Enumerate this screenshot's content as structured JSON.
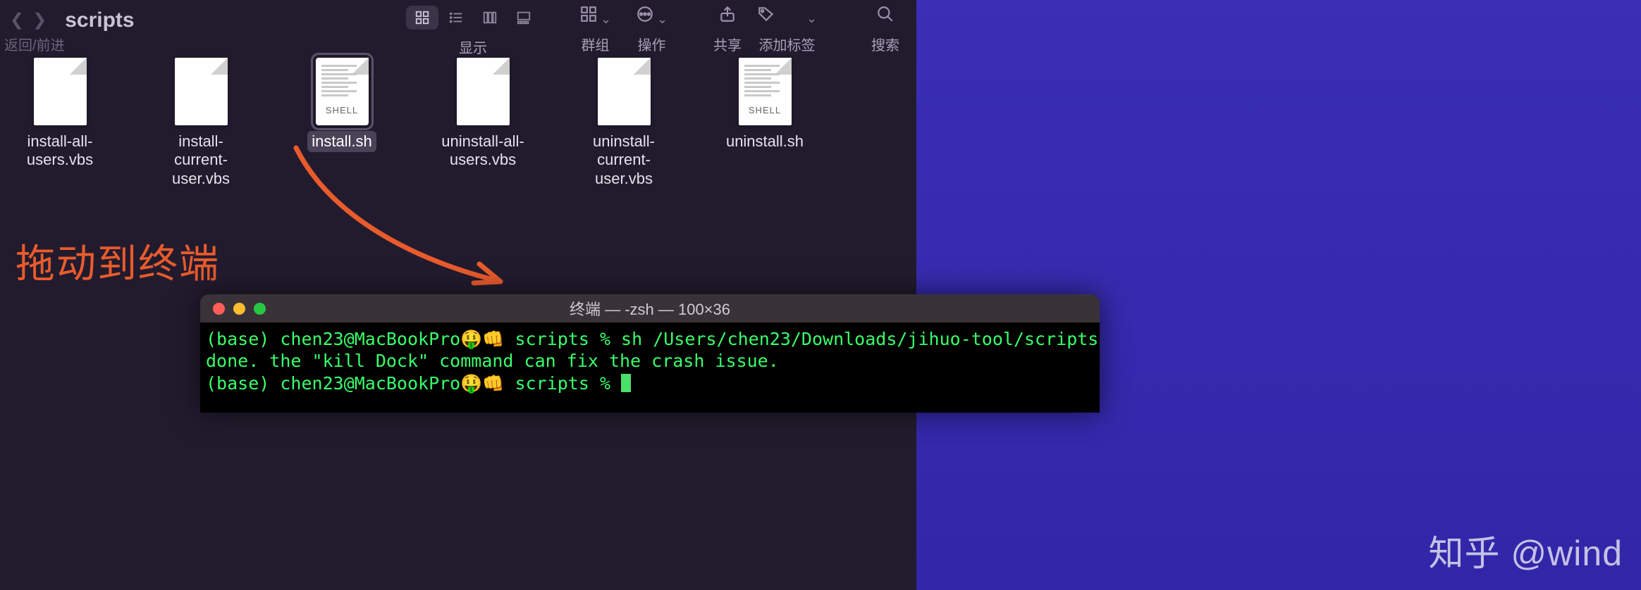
{
  "finder": {
    "nav_back_forward_label": "返回/前进",
    "folder_title": "scripts",
    "view_label": "显示",
    "group_label": "群组",
    "action_label": "操作",
    "share_label": "共享",
    "tags_label": "添加标签",
    "search_label": "搜索",
    "files": [
      {
        "name": "install-all-users.vbs",
        "type": "plain",
        "selected": false
      },
      {
        "name": "install-current-user.vbs",
        "type": "plain",
        "selected": false
      },
      {
        "name": "install.sh",
        "type": "shell",
        "selected": true
      },
      {
        "name": "uninstall-all-users.vbs",
        "type": "plain",
        "selected": false
      },
      {
        "name": "uninstall-current-user.vbs",
        "type": "plain",
        "selected": false
      },
      {
        "name": "uninstall.sh",
        "type": "shell",
        "selected": false
      }
    ]
  },
  "annotation": {
    "text": "拖动到终端",
    "arrow_color": "#e95b2c"
  },
  "terminal": {
    "title": "终端 — -zsh — 100×36",
    "lines": [
      "(base) chen23@MacBookPro🤑👊 scripts % sh /Users/chen23/Downloads/jihuo-tool/scripts/install.sh",
      "done. the \"kill Dock\" command can fix the crash issue.",
      "(base) chen23@MacBookPro🤑👊 scripts % "
    ]
  },
  "watermark": "知乎 @wind"
}
